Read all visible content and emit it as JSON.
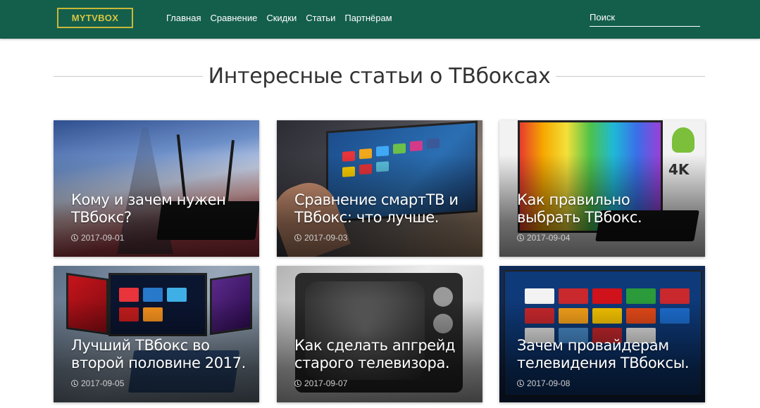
{
  "header": {
    "logo": "MYTVBOX",
    "nav": [
      "Главная",
      "Сравнение",
      "Скидки",
      "Статьи",
      "Партнёрам"
    ],
    "search_placeholder": "Поиск"
  },
  "section": {
    "title": "Интересные статьи о ТВбоксах"
  },
  "articles": [
    {
      "title": "Кому и зачем нужен ТВбокс?",
      "date": "2017-09-01"
    },
    {
      "title": "Сравнение смартТВ и ТВбокс: что лучше.",
      "date": "2017-09-03"
    },
    {
      "title": "Как правильно выбрать ТВбокс.",
      "date": "2017-09-04"
    },
    {
      "title": "Лучший ТВбокс во второй половине 2017.",
      "date": "2017-09-05"
    },
    {
      "title": "Как сделать апгрейд старого телевизора.",
      "date": "2017-09-07"
    },
    {
      "title": "Зачем провайдерам телевидения ТВбоксы.",
      "date": "2017-09-08"
    }
  ],
  "colors": {
    "header_bg": "#145f4c",
    "logo_accent": "#c9b838"
  }
}
